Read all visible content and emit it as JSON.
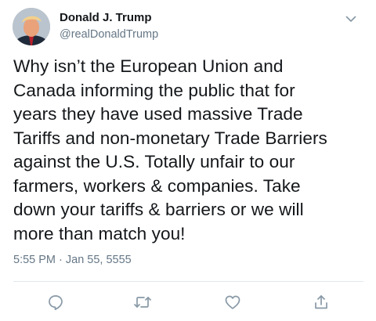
{
  "tweet": {
    "author": {
      "display_name": "Donald J. Trump",
      "handle": "@realDonaldTrump",
      "avatar_icon": "profile-photo"
    },
    "text": "Why isn’t the European Union and\nCanada informing the public that for\nyears they have used massive Trade\nTariffs and non-monetary Trade Barriers\nagainst the U.S. Totally unfair to our\nfarmers, workers & companies. Take\ndown your tariffs & barriers or we will\nmore than match you!",
    "timestamp": "5:55 PM · Jan 55, 5555",
    "actions": [
      {
        "name": "reply",
        "icon": "speech-bubble-icon"
      },
      {
        "name": "retweet",
        "icon": "retweet-arrows-icon"
      },
      {
        "name": "like",
        "icon": "heart-icon"
      },
      {
        "name": "share",
        "icon": "share-upload-icon"
      }
    ]
  },
  "colors": {
    "text_primary": "#14171a",
    "text_secondary": "#657786",
    "icon_gray": "#8899a6",
    "divider": "#e1e8ed"
  }
}
